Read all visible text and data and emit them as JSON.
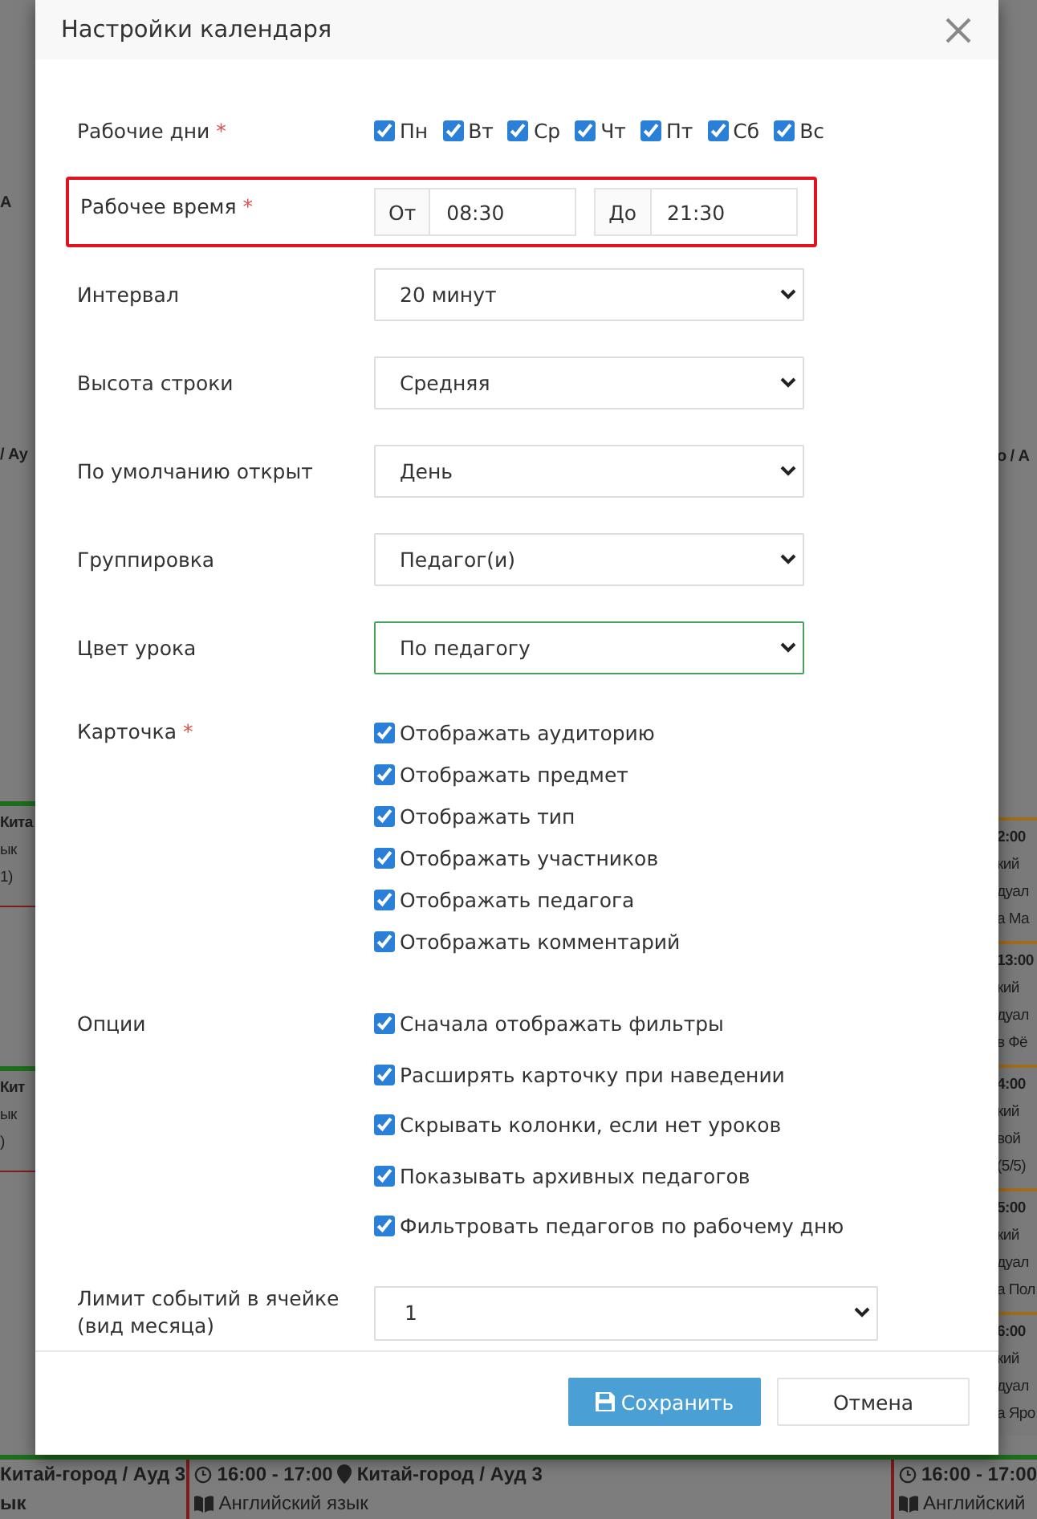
{
  "background": {
    "left_headers": [
      "А",
      "/ Ау"
    ],
    "right_header": "о / А",
    "left_cards": [
      {
        "lines": [
          "Кита",
          "ык",
          "1)"
        ]
      },
      {
        "lines": [
          "Кит",
          "ык",
          ")"
        ]
      }
    ],
    "right_cards": [
      {
        "lines": [
          "2:00",
          "кий",
          "дуал",
          "а Ма"
        ]
      },
      {
        "lines": [
          "13:00",
          "кий",
          "дуал",
          "в Фё"
        ]
      },
      {
        "lines": [
          "4:00",
          "кий",
          "вой",
          "(5/5)"
        ]
      },
      {
        "lines": [
          "5:00",
          "кий",
          "дуал",
          "а Пол"
        ]
      },
      {
        "lines": [
          "6:00",
          "кий",
          "дуал",
          "а Яро"
        ]
      }
    ],
    "bottom_left": [
      "Китай-город / Ауд 3",
      "ык"
    ],
    "bottom_cards": [
      {
        "time": "16:00 - 17:00",
        "place": "Китай-город / Ауд 3",
        "subject": "Английский язык"
      },
      {
        "time": "16:00 - 17:00",
        "subject": "Английский"
      }
    ]
  },
  "dialog": {
    "title": "Настройки календаря",
    "fields": [
      {
        "kind": "days",
        "label": "Рабочие дни",
        "required_mark": "*",
        "days": [
          {
            "label": "Пн",
            "checked": true
          },
          {
            "label": "Вт",
            "checked": true
          },
          {
            "label": "Ср",
            "checked": true
          },
          {
            "label": "Чт",
            "checked": true
          },
          {
            "label": "Пт",
            "checked": true
          },
          {
            "label": "Сб",
            "checked": true
          },
          {
            "label": "Вс",
            "checked": true
          }
        ]
      },
      {
        "kind": "time",
        "label": "Рабочее время",
        "required_mark": "*",
        "highlighted": true,
        "from": {
          "addon": "От",
          "value": "08:30"
        },
        "to": {
          "addon": "До",
          "value": "21:30"
        }
      },
      {
        "kind": "select",
        "label": "Интервал",
        "value": "20 минут",
        "focused": false
      },
      {
        "kind": "select",
        "label": "Высота строки",
        "value": "Средняя",
        "focused": false
      },
      {
        "kind": "select",
        "label": "По умолчанию открыт",
        "value": "День",
        "focused": false
      },
      {
        "kind": "select",
        "label": "Группировка",
        "value": "Педагог(и)",
        "focused": false
      },
      {
        "kind": "select",
        "label": "Цвет урока",
        "value": "По педагогу",
        "focused": true
      },
      {
        "kind": "checklist",
        "label": "Карточка",
        "required_mark": "*",
        "options": [
          {
            "label": "Отображать аудиторию",
            "checked": true
          },
          {
            "label": "Отображать предмет",
            "checked": true
          },
          {
            "label": "Отображать тип",
            "checked": true
          },
          {
            "label": "Отображать участников",
            "checked": true
          },
          {
            "label": "Отображать педагога",
            "checked": true
          },
          {
            "label": "Отображать комментарий",
            "checked": true
          }
        ]
      },
      {
        "kind": "optionlist",
        "label": "Опции",
        "options": [
          {
            "label": "Сначала отображать фильтры",
            "checked": true
          },
          {
            "label": "Расширять карточку при наведении",
            "checked": true
          },
          {
            "label": "Скрывать колонки, если нет уроков",
            "checked": true
          },
          {
            "label": "Показывать архивных педагогов",
            "checked": true
          },
          {
            "label": "Фильтровать педагогов по рабочему дню",
            "checked": true
          }
        ]
      },
      {
        "kind": "wideselect",
        "label": "Лимит событий в ячейке (вид месяца)",
        "value": "1",
        "focused": false
      }
    ],
    "buttons": [
      {
        "kind": "primary",
        "label": "Сохранить"
      },
      {
        "kind": "default",
        "label": "Отмена"
      }
    ]
  }
}
